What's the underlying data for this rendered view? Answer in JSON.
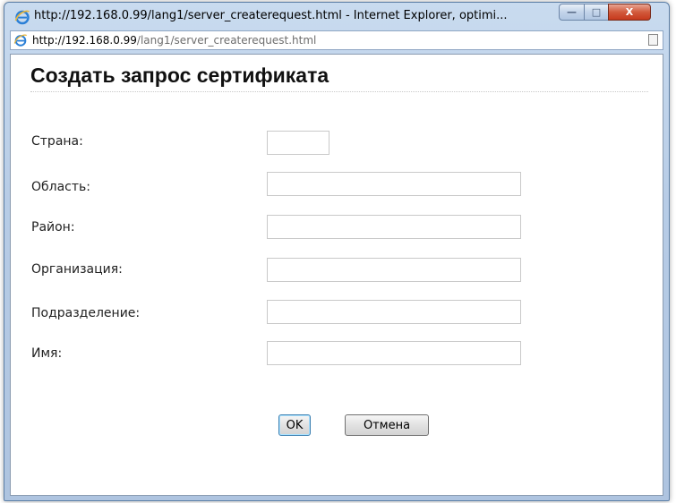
{
  "window": {
    "title": "http://192.168.0.99/lang1/server_createrequest.html - Internet Explorer, optimi...",
    "minimize_glyph": "—",
    "maximize_glyph": "□",
    "close_glyph": "X"
  },
  "addressbar": {
    "url_host": "http://192.168.0.99",
    "url_path": "/lang1/server_createrequest.html"
  },
  "page": {
    "title": "Создать запрос сертификата"
  },
  "form": {
    "fields": [
      {
        "label": "Страна:",
        "value": ""
      },
      {
        "label": "Область:",
        "value": ""
      },
      {
        "label": "Район:",
        "value": ""
      },
      {
        "label": "Организация:",
        "value": ""
      },
      {
        "label": "Подразделение:",
        "value": ""
      },
      {
        "label": "Имя:",
        "value": ""
      }
    ],
    "ok_label": "OK",
    "cancel_label": "Отмена"
  },
  "colors": {
    "titlebar": "#b7cce6",
    "close_button": "#c6391c",
    "ie_logo": "#2a7fd6"
  },
  "icons": {
    "browser": "internet-explorer-icon",
    "page": "page-icon"
  }
}
